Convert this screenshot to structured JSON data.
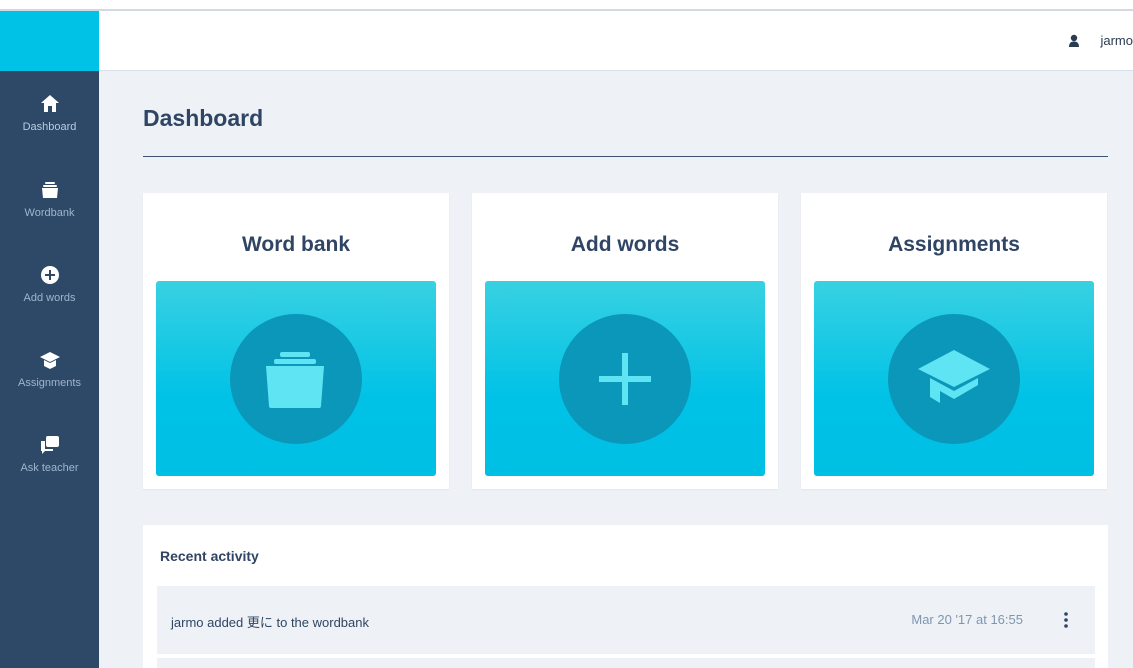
{
  "sidebar": {
    "items": [
      {
        "label": "Dashboard",
        "icon": "home-icon",
        "active": true
      },
      {
        "label": "Wordbank",
        "icon": "folder-icon"
      },
      {
        "label": "Add words",
        "icon": "plus-circle-icon"
      },
      {
        "label": "Assignments",
        "icon": "graduation-cap-icon"
      },
      {
        "label": "Ask teacher",
        "icon": "chat-icon"
      }
    ]
  },
  "header": {
    "username": "jarmo",
    "user_icon": "user-icon"
  },
  "main": {
    "title": "Dashboard",
    "cards": [
      {
        "title": "Word bank",
        "icon": "folder-icon"
      },
      {
        "title": "Add words",
        "icon": "plus-icon"
      },
      {
        "title": "Assignments",
        "icon": "graduation-cap-icon"
      }
    ],
    "activity": {
      "title": "Recent activity",
      "items": [
        {
          "text": "jarmo added 更に to the wordbank",
          "time": "Mar 20 '17 at 16:55",
          "menu_icon": "more-vertical-icon"
        }
      ]
    }
  },
  "colors": {
    "sidebar": "#2e4868",
    "accent": "#00c2e6",
    "icon_circle": "#0b97b9",
    "icon_fill": "#5fe4f3"
  }
}
